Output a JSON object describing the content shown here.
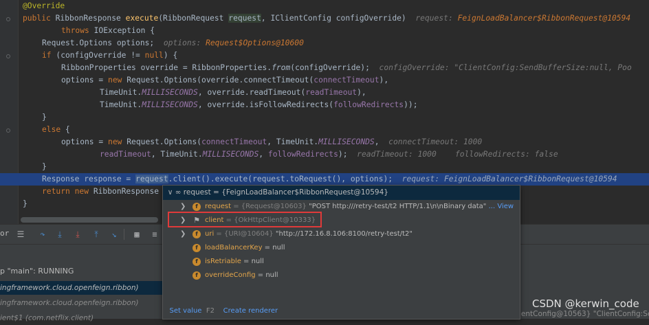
{
  "code": {
    "l1_ann": "@Override",
    "l2_a": "public ",
    "l2_b": "RibbonResponse ",
    "l2_fn": "execute",
    "l2_c": "(RibbonRequest ",
    "l2_p": "request",
    "l2_d": ", IClientConfig configOverride)",
    "l2_hint": "request: ",
    "l2_hintv": "FeignLoadBalancer$RibbonRequest@10594",
    "l3_kw": "throws ",
    "l3_b": "IOException {",
    "l4_a": "Request.Options options;",
    "l4_hint": "options: ",
    "l4_hintv": "Request$Options@10600",
    "l5_kw": "if ",
    "l5_b": "(configOverride != ",
    "l5_null": "null",
    "l5_c": ") {",
    "l6_a": "RibbonProperties override = RibbonProperties.",
    "l6_fn": "from",
    "l6_b": "(configOverride);",
    "l6_hint": "configOverride: \"ClientConfig:SendBufferSize:null, Poo",
    "l7_a": "options = ",
    "l7_kw": "new ",
    "l7_b": "Request.Options(override.connectTimeout(",
    "l7_f": "connectTimeout",
    "l7_c": "),",
    "l8_a": "TimeUnit.",
    "l8_f": "MILLISECONDS",
    "l8_b": ", override.readTimeout(",
    "l8_f2": "readTimeout",
    "l8_c": "),",
    "l9_a": "TimeUnit.",
    "l9_f": "MILLISECONDS",
    "l9_b": ", override.isFollowRedirects(",
    "l9_f2": "followRedirects",
    "l9_c": "));",
    "l10": "}",
    "l11_kw": "else ",
    "l11_b": "{",
    "l12_a": "options = ",
    "l12_kw": "new ",
    "l12_b": "Request.Options(",
    "l12_f": "connectTimeout",
    "l12_c": ", TimeUnit.",
    "l12_f2": "MILLISECONDS",
    "l12_d": ",",
    "l12_hint": "connectTimeout: ",
    "l12_hintv": "1000",
    "l13_f": "readTimeout",
    "l13_a": ", TimeUnit.",
    "l13_f2": "MILLISECONDS",
    "l13_b": ", ",
    "l13_f3": "followRedirects",
    "l13_c": ");",
    "l13_hint1": "readTimeout: ",
    "l13_hintv1": "1000",
    "l13_hint2": "followRedirects: ",
    "l13_hintv2": "false",
    "l14": "}",
    "l15_a": "Response response = ",
    "l15_sel": "request",
    "l15_b": ".client().execute(request.toRequest(), options);",
    "l15_hint": "request: ",
    "l15_hintv": "FeignLoadBalancer$RibbonRequest@10594",
    "l16_kw": "return new ",
    "l16_b": "RibbonResponse",
    "l17": "}"
  },
  "debug": {
    "toolbar_label": "or",
    "thread": "p \"main\": RUNNING",
    "frames": [
      "ingframework.cloud.openfeign.ribbon)",
      "ingframework.cloud.openfeign.ribbon)",
      "ient$1 (com.netflix.client)"
    ],
    "frame_right": "ientConfig@10563} \"ClientConfig:Send"
  },
  "popup": {
    "header": "∞ request = {FeignLoadBalancer$RibbonRequest@10594}",
    "rows": [
      {
        "name": "request",
        "ref": " = {Request@10603} ",
        "val": "\"POST http:///retry-test/t2 HTTP/1.1\\n\\nBinary data\"",
        "view": " ... View"
      },
      {
        "name": "client",
        "ref": " = {OkHttpClient@10333}",
        "val": "",
        "view": ""
      },
      {
        "name": "uri",
        "ref": " = {URI@10604} ",
        "val": "\"http://172.16.8.106:8100/retry-test/t2\"",
        "view": ""
      },
      {
        "name": "loadBalancerKey",
        "ref": "",
        "val": " = null",
        "view": ""
      },
      {
        "name": "isRetriable",
        "ref": "",
        "val": " = null",
        "view": ""
      },
      {
        "name": "overrideConfig",
        "ref": "",
        "val": " = null",
        "view": ""
      }
    ],
    "set_value": "Set value",
    "set_value_key": "F2",
    "create_renderer": "Create renderer"
  },
  "watermark": "CSDN @kerwin_code"
}
